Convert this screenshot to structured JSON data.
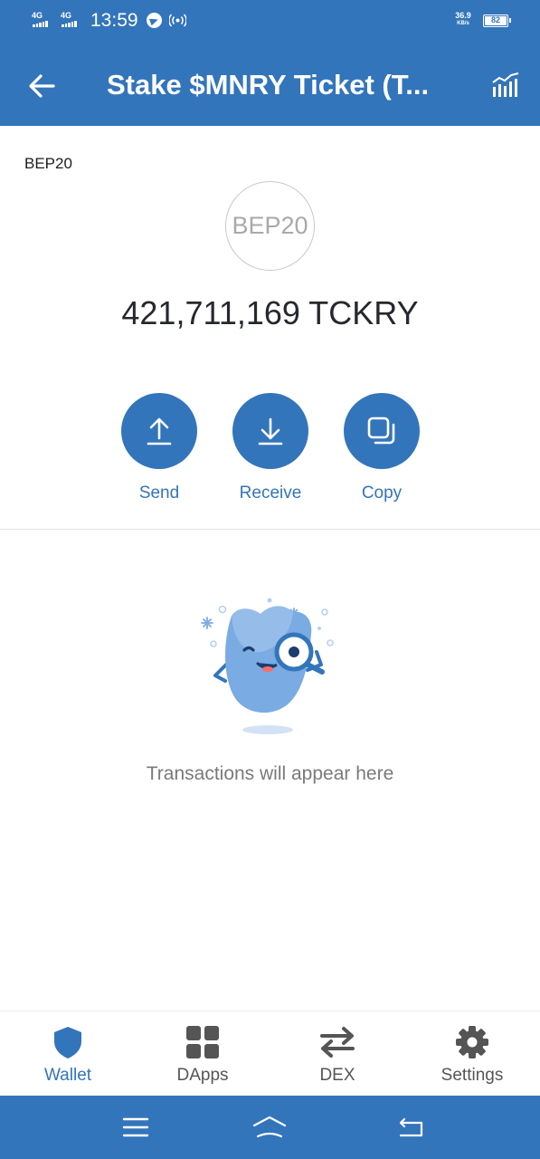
{
  "status_bar": {
    "network_1": "4G",
    "network_2": "4G",
    "time": "13:59",
    "speed_value": "36.9",
    "speed_unit": "KB/s",
    "battery": "82"
  },
  "header": {
    "title": "Stake $MNRY Ticket (T...",
    "back_icon": "arrow-left-icon",
    "chart_icon": "market-chart-icon",
    "background_color": "#3375bb"
  },
  "token": {
    "network_label": "BEP20",
    "logo_text": "BEP20",
    "balance": "421,711,169 TCKRY"
  },
  "actions": [
    {
      "label": "Send",
      "icon": "upload-arrow-icon"
    },
    {
      "label": "Receive",
      "icon": "download-arrow-icon"
    },
    {
      "label": "Copy",
      "icon": "copy-icon"
    }
  ],
  "empty_state": {
    "message": "Transactions will appear here",
    "illustration": "mascot-magnifier-icon"
  },
  "tabs": [
    {
      "label": "Wallet",
      "icon": "shield-icon",
      "active": true
    },
    {
      "label": "DApps",
      "icon": "grid-icon",
      "active": false
    },
    {
      "label": "DEX",
      "icon": "swap-arrows-icon",
      "active": false
    },
    {
      "label": "Settings",
      "icon": "gear-icon",
      "active": false
    }
  ],
  "system_nav": {
    "menu_icon": "menu-icon",
    "home_icon": "home-icon",
    "back_icon": "back-icon"
  },
  "colors": {
    "accent": "#3375bb",
    "tab_inactive": "#555555",
    "mascot_body": "#7aabe3"
  }
}
